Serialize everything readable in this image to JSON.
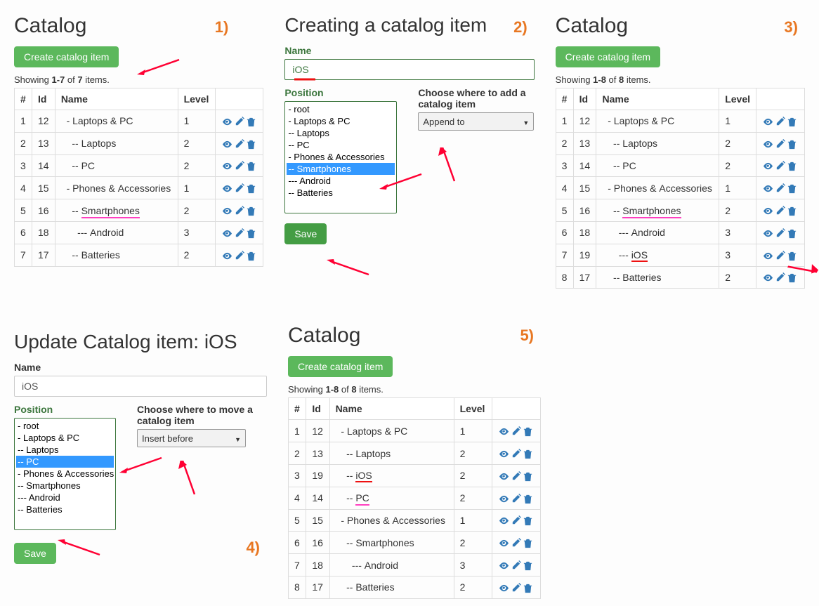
{
  "labels": {
    "catalog_title": "Catalog",
    "create_btn": "Create catalog item",
    "creating_title": "Creating a catalog item",
    "update_title": "Update Catalog item: iOS",
    "name": "Name",
    "position": "Position",
    "choose_add": "Choose where to add a catalog item",
    "choose_move": "Choose where to move a catalog item",
    "save": "Save",
    "append_to": "Append to",
    "insert_before": "Insert before"
  },
  "steps": {
    "s1": "1)",
    "s2": "2)",
    "s3": "3)",
    "s4": "4)",
    "s5": "5)"
  },
  "headers": {
    "num": "#",
    "id": "Id",
    "name": "Name",
    "level": "Level"
  },
  "showing": {
    "p1_a": "Showing ",
    "p1_b": "1-7",
    "p1_c": " of ",
    "p1_d": "7",
    "p1_e": " items.",
    "p3_a": "Showing ",
    "p3_b": "1-8",
    "p3_c": " of ",
    "p3_d": "8",
    "p3_e": " items.",
    "p5_a": "Showing ",
    "p5_b": "1-8",
    "p5_c": " of ",
    "p5_d": "8",
    "p5_e": " items."
  },
  "form": {
    "ios": "iOS"
  },
  "tree": {
    "root": "- root",
    "laptops_pc": "  - Laptops & PC",
    "laptops": "     -- Laptops",
    "pc": "     -- PC",
    "phones": "  - Phones & Accessories",
    "smart": "     -- Smartphones",
    "android": "        --- Android",
    "batt": "     -- Batteries"
  },
  "panel1": {
    "rows": [
      {
        "n": "1",
        "id": "12",
        "name": "  - Laptops & PC",
        "lvl": "1"
      },
      {
        "n": "2",
        "id": "13",
        "name": "    -- Laptops",
        "lvl": "2"
      },
      {
        "n": "3",
        "id": "14",
        "name": "    -- PC",
        "lvl": "2"
      },
      {
        "n": "4",
        "id": "15",
        "name": "  - Phones & Accessories",
        "lvl": "1"
      },
      {
        "n": "5",
        "id": "16",
        "name_pre": "    -- ",
        "name_ul": "Smartphones",
        "lvl": "2"
      },
      {
        "n": "6",
        "id": "18",
        "name": "      --- Android",
        "lvl": "3"
      },
      {
        "n": "7",
        "id": "17",
        "name": "    -- Batteries",
        "lvl": "2"
      }
    ]
  },
  "panel3": {
    "rows": [
      {
        "n": "1",
        "id": "12",
        "name": "  - Laptops & PC",
        "lvl": "1"
      },
      {
        "n": "2",
        "id": "13",
        "name": "    -- Laptops",
        "lvl": "2"
      },
      {
        "n": "3",
        "id": "14",
        "name": "    -- PC",
        "lvl": "2"
      },
      {
        "n": "4",
        "id": "15",
        "name": "  - Phones & Accessories",
        "lvl": "1"
      },
      {
        "n": "5",
        "id": "16",
        "name_pre": "    -- ",
        "name_ul": "Smartphones",
        "lvl": "2"
      },
      {
        "n": "6",
        "id": "18",
        "name": "      --- Android",
        "lvl": "3"
      },
      {
        "n": "7",
        "id": "19",
        "name_pre": "      --- ",
        "name_ul2": "iOS",
        "lvl": "3"
      },
      {
        "n": "8",
        "id": "17",
        "name": "    -- Batteries",
        "lvl": "2"
      }
    ]
  },
  "panel5": {
    "rows": [
      {
        "n": "1",
        "id": "12",
        "name": "  - Laptops & PC",
        "lvl": "1"
      },
      {
        "n": "2",
        "id": "13",
        "name": "    -- Laptops",
        "lvl": "2"
      },
      {
        "n": "3",
        "id": "19",
        "name_pre": "    -- ",
        "name_ul2": "iOS",
        "lvl": "2"
      },
      {
        "n": "4",
        "id": "14",
        "name_pre": "    -- ",
        "name_ul": "PC",
        "lvl": "2"
      },
      {
        "n": "5",
        "id": "15",
        "name": "  - Phones & Accessories",
        "lvl": "1"
      },
      {
        "n": "6",
        "id": "16",
        "name": "    -- Smartphones",
        "lvl": "2"
      },
      {
        "n": "7",
        "id": "18",
        "name": "      --- Android",
        "lvl": "3"
      },
      {
        "n": "8",
        "id": "17",
        "name": "    -- Batteries",
        "lvl": "2"
      }
    ]
  }
}
